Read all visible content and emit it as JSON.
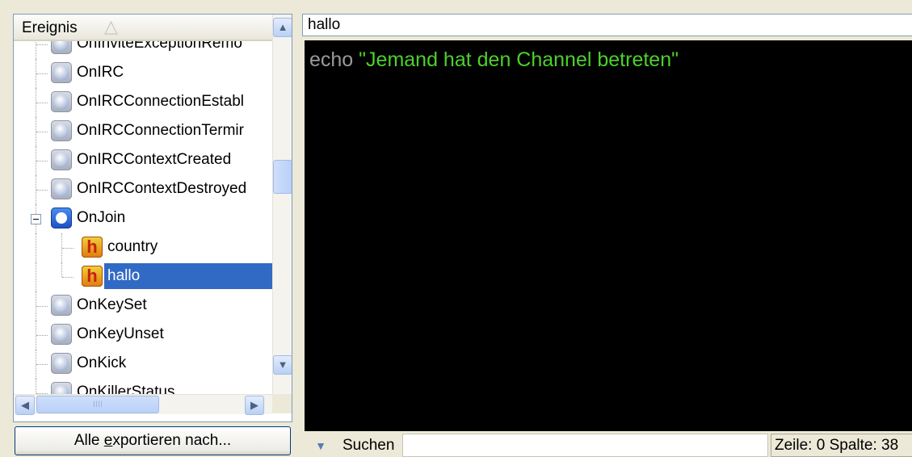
{
  "tree": {
    "header_label": "Ereignis",
    "items": [
      {
        "label": "OnInviteExceptionRemo"
      },
      {
        "label": "OnIRC"
      },
      {
        "label": "OnIRCConnectionEstabl"
      },
      {
        "label": "OnIRCConnectionTermir"
      },
      {
        "label": "OnIRCContextCreated"
      },
      {
        "label": "OnIRCContextDestroyed"
      },
      {
        "label": "OnJoin"
      },
      {
        "label": "country"
      },
      {
        "label": "hallo"
      },
      {
        "label": "OnKeySet"
      },
      {
        "label": "OnKeyUnset"
      },
      {
        "label": "OnKick"
      },
      {
        "label": "OnKillerStatus"
      }
    ],
    "selected": "hallo",
    "hscroll_thumb_grip": "IIII"
  },
  "export_button": {
    "prefix": "Alle ",
    "accel": "e",
    "suffix": "xportieren nach..."
  },
  "editor": {
    "script_name": "hallo",
    "code_keyword": "echo ",
    "code_string": "\"Jemand hat den Channel betreten\""
  },
  "statusbar": {
    "search_label": "Suchen",
    "search_value": "",
    "position_text": "Zeile: 0 Spalte: 38"
  },
  "colors": {
    "selection": "#316ac5",
    "string": "#4cd12a",
    "keyword": "#9a9a9a",
    "editor_bg": "#000000"
  }
}
